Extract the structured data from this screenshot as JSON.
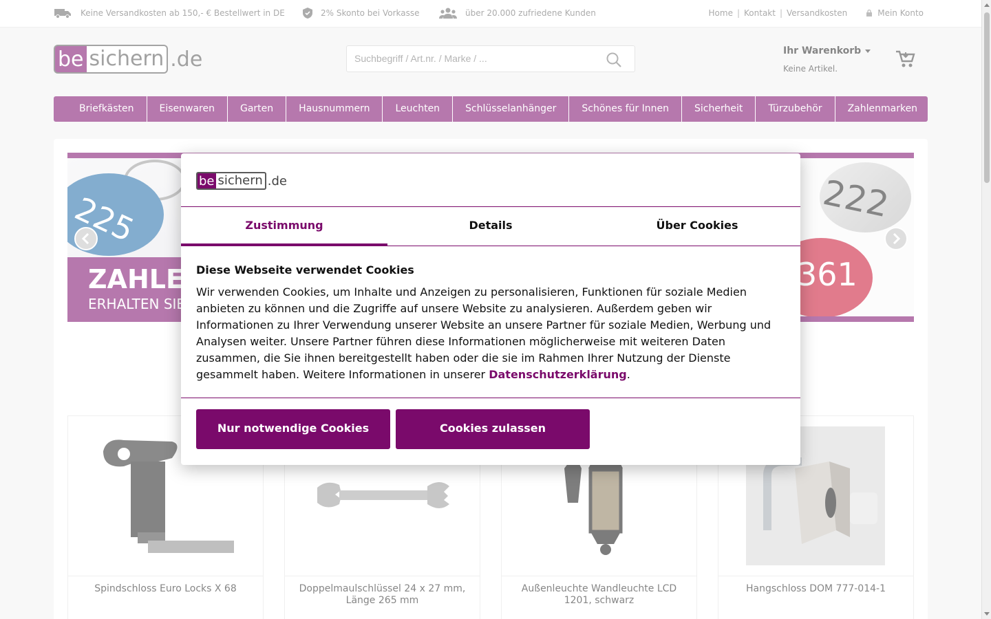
{
  "topbar": {
    "usps": [
      {
        "icon": "truck-icon",
        "text": "Keine Versandkosten ab 150,- € Bestellwert in DE"
      },
      {
        "icon": "shield-check-icon",
        "text": "2% Skonto bei Vorkasse"
      },
      {
        "icon": "users-icon",
        "text": "über 20.000 zufriedene Kunden"
      }
    ],
    "links": [
      "Home",
      "Kontakt",
      "Versandkosten"
    ],
    "separator": "|",
    "account": "Mein Konto"
  },
  "logo": {
    "part1": "be",
    "part2": "sichern",
    "part3": ".de"
  },
  "search": {
    "placeholder": "Suchbegriff / Art.nr. / Marke / ..."
  },
  "cart": {
    "title": "Ihr Warenkorb",
    "status": "Keine Artikel."
  },
  "nav": [
    "Briefkästen",
    "Eisenwaren",
    "Garten",
    "Hausnummern",
    "Leuchten",
    "Schlüsselanhänger",
    "Schönes für Innen",
    "Sicherheit",
    "Türzubehör",
    "Zahlenmarken"
  ],
  "slider": {
    "headline": "ZAHLEN",
    "subline": "ERHALTEN SIE",
    "tag_numbers": [
      "225",
      "222",
      "361"
    ]
  },
  "products": [
    {
      "name": "Spindschloss Euro Locks X 68"
    },
    {
      "name": "Doppelmaulschlüssel 24 x 27 mm, Länge 265 mm"
    },
    {
      "name": "Außenleuchte Wandleuchte LCD 1201, schwarz"
    },
    {
      "name": "Hangschloss DOM 777-014-1"
    }
  ],
  "cookie": {
    "tabs": [
      "Zustimmung",
      "Details",
      "Über Cookies"
    ],
    "heading": "Diese Webseite verwendet Cookies",
    "body": "Wir verwenden Cookies, um Inhalte und Anzeigen zu personalisieren, Funktionen für soziale Medien anbieten zu können und die Zugriffe auf unsere Website zu analysieren. Außerdem geben wir Informationen zu Ihrer Verwendung unserer Website an unsere Partner für soziale Medien, Werbung und Analysen weiter. Unsere Partner führen diese Informationen möglicherweise mit weiteren Daten zusammen, die Sie ihnen bereitgestellt haben oder die sie im Rahmen Ihrer Nutzung der Dienste gesammelt haben. Weitere Informationen in unserer ",
    "link": "Datenschutzerklärung",
    "link_suffix": ".",
    "btn_necessary": "Nur notwendige Cookies",
    "btn_allow": "Cookies zulassen"
  },
  "colors": {
    "brand": "#7a0a6b"
  }
}
